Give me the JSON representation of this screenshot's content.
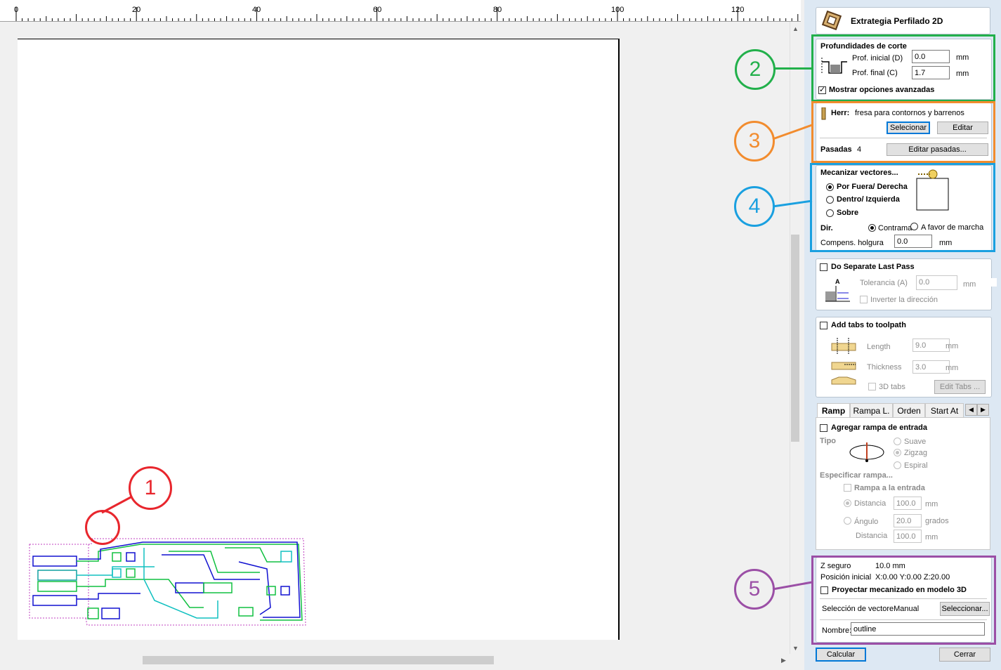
{
  "ruler": {
    "labels": [
      "0",
      "20",
      "40",
      "60",
      "80",
      "100",
      "120"
    ]
  },
  "panel": {
    "title": "Extrategia Perfilado 2D",
    "depths": {
      "heading": "Profundidades de corte",
      "start_label": "Prof. inicial (D)",
      "start_value": "0.0",
      "end_label": "Prof. final (C)",
      "end_value": "1.7",
      "unit": "mm",
      "advanced_label": "Mostrar opciones avanzadas"
    },
    "tool": {
      "label": "Herr:",
      "name": "fresa para contornos y barrenos",
      "select_btn": "Selecionar",
      "edit_btn": "Editar",
      "passes_label": "Pasadas",
      "passes_value": "4",
      "edit_passes_btn": "Editar pasadas..."
    },
    "machining": {
      "heading": "Mecanizar vectores...",
      "opt_outside": "Por Fuera/ Derecha",
      "opt_inside": "Dentro/ Izquierda",
      "opt_on": "Sobre",
      "dir_label": "Dir.",
      "dir_conv": "Contrama",
      "dir_climb": "A favor de marcha",
      "allowance_label": "Compens. holgura",
      "allowance_value": "0.0",
      "unit": "mm"
    },
    "last_pass": {
      "label": "Do Separate Last Pass",
      "tol_label": "Tolerancia (A)",
      "tol_value": "0.0",
      "unit": "mm",
      "reverse_label": "Inverter la dirección",
      "icon_letter": "A"
    },
    "tabs_section": {
      "label": "Add tabs to toolpath",
      "length_label": "Length",
      "length_value": "9.0",
      "thickness_label": "Thickness",
      "thickness_value": "3.0",
      "unit": "mm",
      "tabs3d_label": "3D tabs",
      "edit_btn": "Edit Tabs ..."
    },
    "subtabs": [
      "Ramp",
      "Rampa L.",
      "Orden",
      "Start At"
    ],
    "ramp": {
      "add_label": "Agregar rampa de entrada",
      "type_label": "Tipo",
      "smooth": "Suave",
      "zigzag": "Zigzag",
      "spiral": "Espiral",
      "specify_label": "Especificar rampa...",
      "ramp_in_label": "Rampa a la entrada",
      "dist_label": "Distancia",
      "dist_value": "100.0",
      "angle_label": "Ángulo",
      "angle_value": "20.0",
      "deg_unit": "grados",
      "dist2_label": "Distancia",
      "dist2_value": "100.0",
      "unit": "mm"
    },
    "bottom": {
      "zsafe_label": "Z seguro",
      "zsafe_value": "10.0 mm",
      "home_label": "Posición inicial",
      "home_value": "X:0.00 Y:0.00 Z:20.00",
      "project_label": "Proyectar mecanizado en modelo 3D",
      "vecsel_label": "Selección de vectoreManual",
      "vecsel_btn": "Seleccionar...",
      "name_label": "Nombre:",
      "name_value": "outline"
    },
    "calc_btn": "Calcular",
    "close_btn": "Cerrar"
  },
  "annotations": [
    "1",
    "2",
    "3",
    "4",
    "5"
  ],
  "colors": {
    "red": "#e8262d",
    "green": "#22b04b",
    "orange": "#f28c2e",
    "blue": "#1aa0e0",
    "purple": "#9b4fa6"
  }
}
